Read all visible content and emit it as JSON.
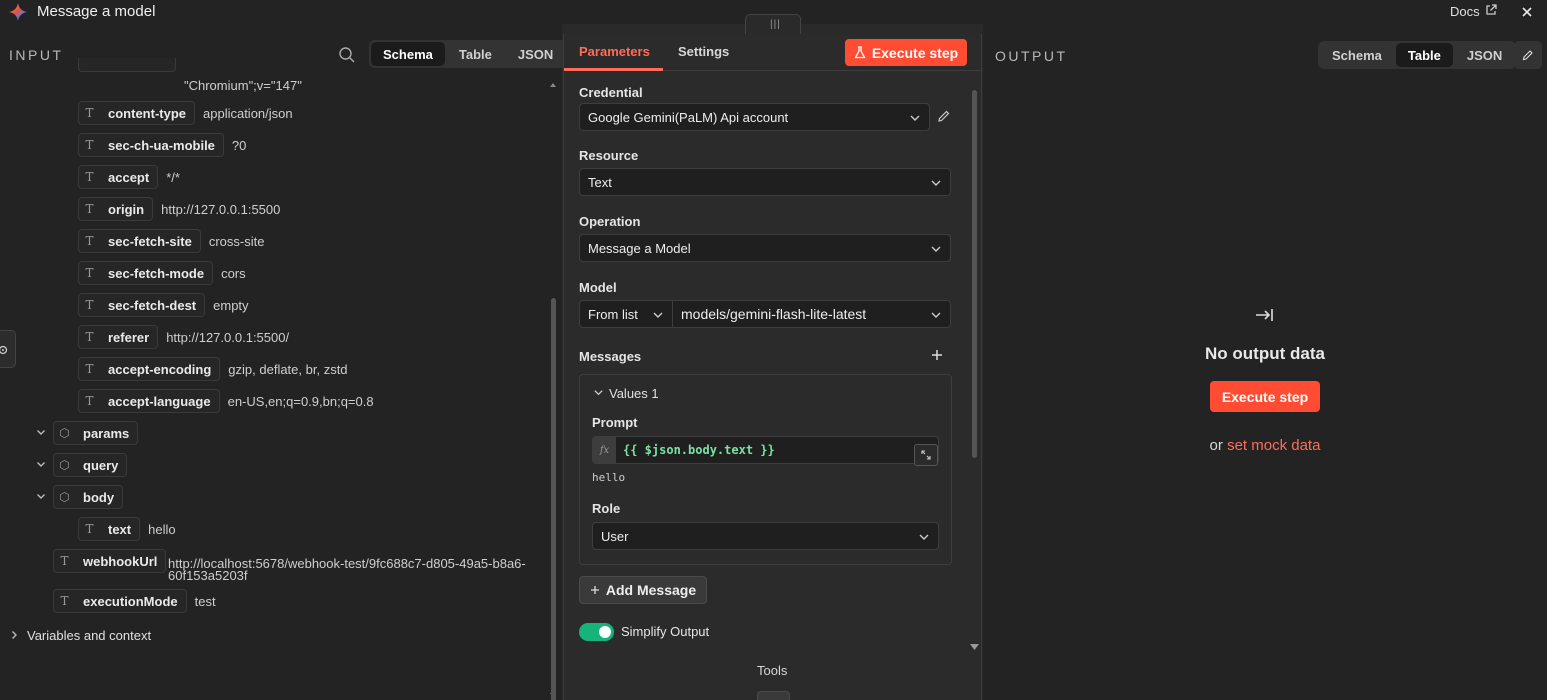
{
  "app": {
    "title": "Message a model",
    "docs_label": "Docs",
    "handle_glyph": "|||"
  },
  "input": {
    "label": "INPUT",
    "tabs": [
      "Schema",
      "Table",
      "JSON"
    ],
    "active_tab": "Schema",
    "partial_value": "\"Chromium\";v=\"147\"",
    "headers": [
      {
        "key": "content-type",
        "value": "application/json"
      },
      {
        "key": "sec-ch-ua-mobile",
        "value": "?0"
      },
      {
        "key": "accept",
        "value": "*/*"
      },
      {
        "key": "origin",
        "value": "http://127.0.0.1:5500"
      },
      {
        "key": "sec-fetch-site",
        "value": "cross-site"
      },
      {
        "key": "sec-fetch-mode",
        "value": "cors"
      },
      {
        "key": "sec-fetch-dest",
        "value": "empty"
      },
      {
        "key": "referer",
        "value": "http://127.0.0.1:5500/"
      },
      {
        "key": "accept-encoding",
        "value": "gzip, deflate, br, zstd"
      },
      {
        "key": "accept-language",
        "value": "en-US,en;q=0.9,bn;q=0.8"
      }
    ],
    "objects": [
      "params",
      "query",
      "body"
    ],
    "body_text": {
      "key": "text",
      "value": "hello"
    },
    "webhook_url": {
      "key": "webhookUrl",
      "value_line1": "http://localhost:5678/webhook-test/9fc688c7-d805-49a5-b8a6-",
      "value_line2": "60f153a5203f"
    },
    "execution_mode": {
      "key": "executionMode",
      "value": "test"
    },
    "variables_label": "Variables and context"
  },
  "params": {
    "tabs": [
      "Parameters",
      "Settings"
    ],
    "active_tab": "Parameters",
    "execute_label": "Execute step",
    "credential": {
      "label": "Credential",
      "value": "Google Gemini(PaLM) Api account"
    },
    "resource": {
      "label": "Resource",
      "value": "Text"
    },
    "operation": {
      "label": "Operation",
      "value": "Message a Model"
    },
    "model": {
      "label": "Model",
      "mode": "From list",
      "value": "models/gemini-flash-lite-latest"
    },
    "messages": {
      "label": "Messages",
      "group_label": "Values 1",
      "prompt_label": "Prompt",
      "prompt_expression": "{{ $json.body.text }}",
      "prompt_preview": "hello",
      "role_label": "Role",
      "role_value": "User"
    },
    "add_message_label": "Add Message",
    "simplify_label": "Simplify Output",
    "simplify_on": true,
    "tools_label": "Tools"
  },
  "output": {
    "label": "OUTPUT",
    "tabs": [
      "Schema",
      "Table",
      "JSON"
    ],
    "active_tab": "Table",
    "empty_title": "No output data",
    "execute_label": "Execute step",
    "or_text": "or",
    "mock_link": "set mock data"
  },
  "colors": {
    "accent": "#ff4c33",
    "link": "#ff6d5a",
    "code": "#7ce2a2",
    "toggle_on": "#16b37b"
  }
}
